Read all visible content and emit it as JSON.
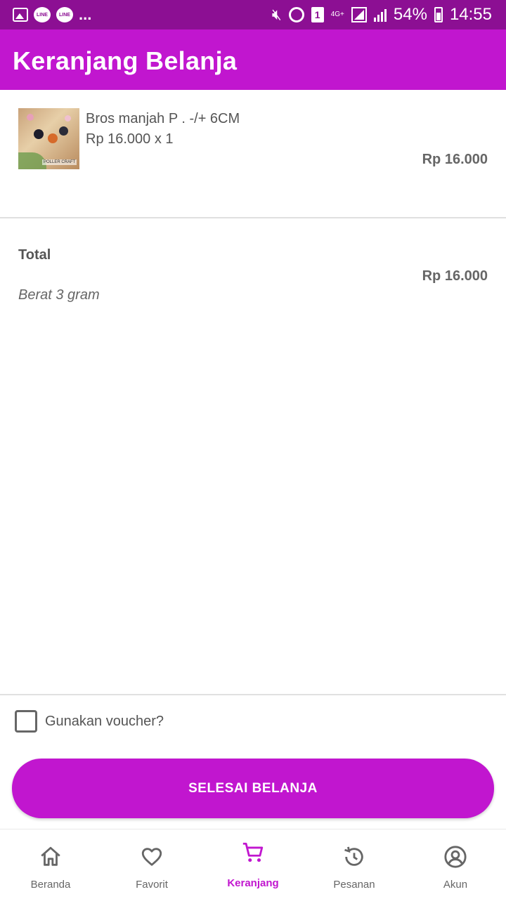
{
  "status_bar": {
    "line_label_1": "LINE",
    "line_label_2": "LINE",
    "more": "...",
    "sim_slot": "1",
    "network": "4G+",
    "battery": "54%",
    "time": "14:55"
  },
  "app_bar": {
    "title": "Keranjang Belanja"
  },
  "cart": {
    "items": [
      {
        "name": "Bros manjah P . -/+ 6CM",
        "qty_line": "Rp 16.000 x 1",
        "subtotal": "Rp 16.000",
        "thumb_brand": "POLLER CRAFT"
      }
    ],
    "total_label": "Total",
    "total_value": "Rp 16.000",
    "weight": "Berat 3 gram"
  },
  "voucher": {
    "label": "Gunakan voucher?",
    "checked": false
  },
  "checkout_button": "SELESAI BELANJA",
  "bottom_nav": [
    {
      "label": "Beranda",
      "icon": "home-icon",
      "active": false
    },
    {
      "label": "Favorit",
      "icon": "heart-icon",
      "active": false
    },
    {
      "label": "Keranjang",
      "icon": "cart-icon",
      "active": true
    },
    {
      "label": "Pesanan",
      "icon": "history-icon",
      "active": false
    },
    {
      "label": "Akun",
      "icon": "account-icon",
      "active": false
    }
  ],
  "colors": {
    "status_bar": "#8c0f93",
    "primary": "#c116cf",
    "text": "#555555"
  }
}
